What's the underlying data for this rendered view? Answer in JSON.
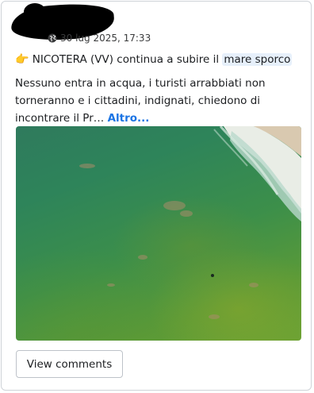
{
  "post": {
    "timestamp": "30 lug 2025, 17:33",
    "title_prefix": "NICOTERA (VV) continua a subire il ",
    "title_highlight": "mare sporco",
    "body": "Nessuno entra in acqua, i turisti arrabbiati non torneranno e i cittadini, indignati, chiedono di incontrare il Pr… ",
    "more_label": "Altro...",
    "emoji": "👉",
    "privacy_icon": "globe-icon"
  },
  "actions": {
    "view_comments_label": "View comments"
  },
  "colors": {
    "link": "#1b74e4",
    "highlight_bg": "#e7f0fb",
    "water_dark": "#2f7a5d",
    "water_green": "#5a9a38",
    "foam": "#f4f1ea",
    "sand": "#d9c9b0"
  }
}
